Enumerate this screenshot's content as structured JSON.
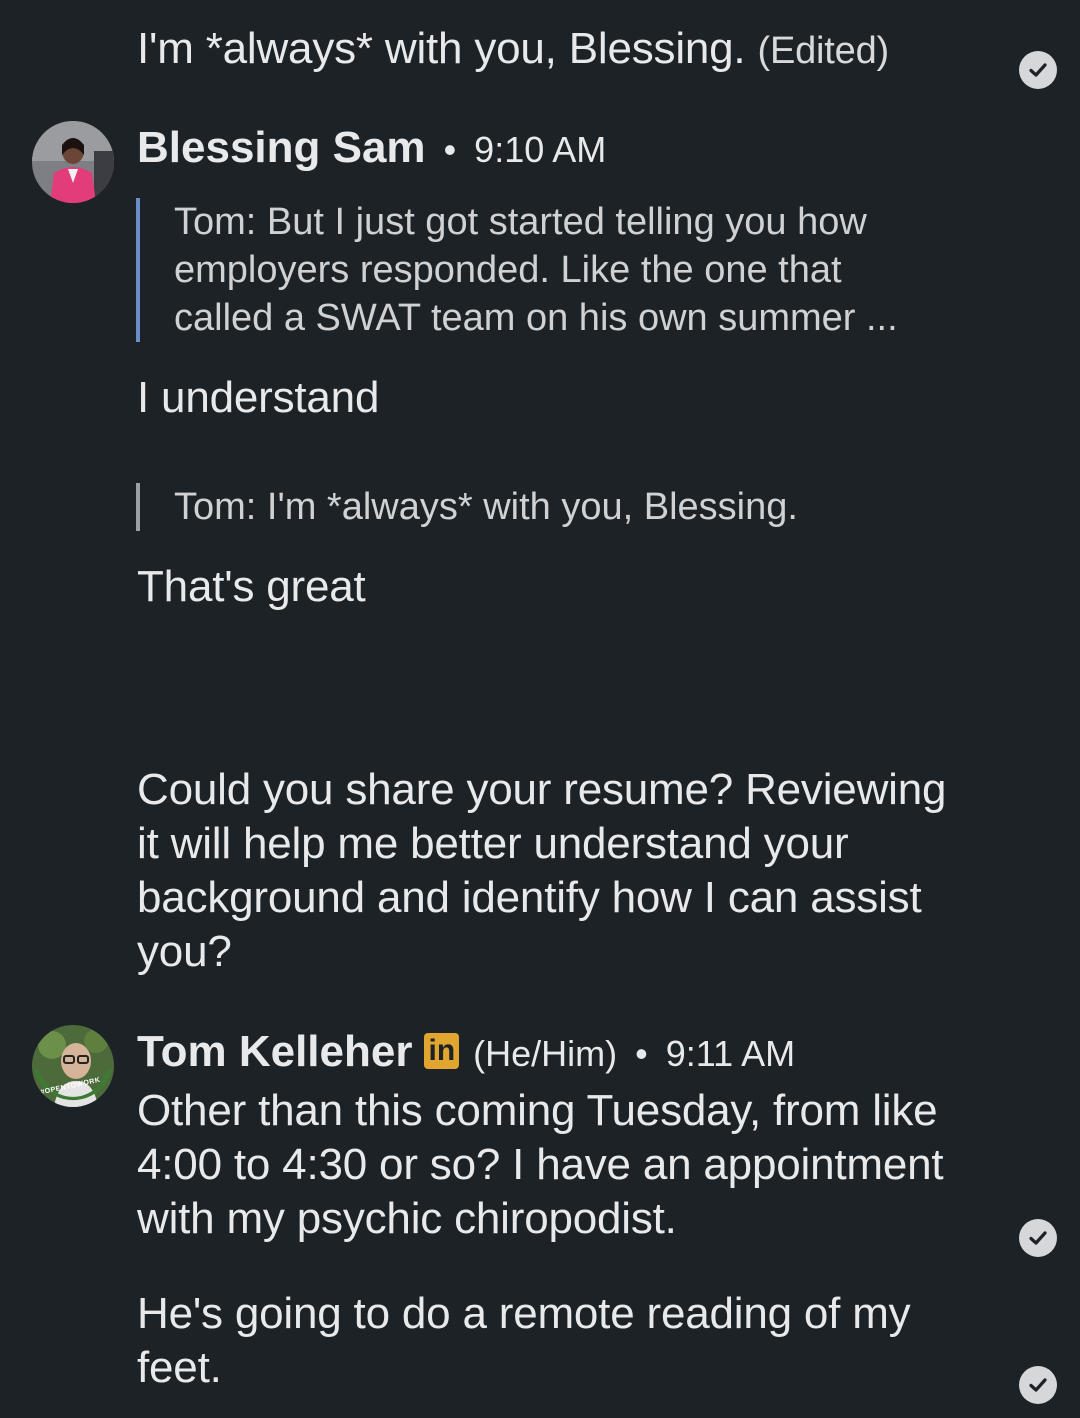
{
  "messages": {
    "first": {
      "text": "I'm *always* with you, Blessing.",
      "edited_label": "(Edited)",
      "status_icon": "check-circle-icon"
    },
    "blessing": {
      "name": "Blessing Sam",
      "time": "9:10 AM",
      "quote1": "Tom: But I just got started telling you how employers responded.  Like the one that called a SWAT team on his own summer ...",
      "reply1": "I understand",
      "quote2": "Tom: I'm *always* with you, Blessing.",
      "reply2": "That's great",
      "message3": "Could you share your resume? Reviewing it will help me better understand your background and identify how I can assist you?"
    },
    "tom": {
      "name": "Tom Kelleher",
      "badge": "in",
      "pronouns": "(He/Him)",
      "time": "9:11 AM",
      "avatar_ring_text": "#OPENTOWORK",
      "message1": "Other than this coming Tuesday, from like 4:00 to 4:30 or so?  I have an appointment with my psychic chiropodist.",
      "message2": "He's going to do a remote reading of my feet."
    }
  },
  "colors": {
    "background": "#1d2226",
    "text": "#e8e9ea",
    "quote_bar": "#6b8ec9",
    "linkedin_badge": "#e0a62f",
    "opentowork_green": "#3f7a35"
  }
}
